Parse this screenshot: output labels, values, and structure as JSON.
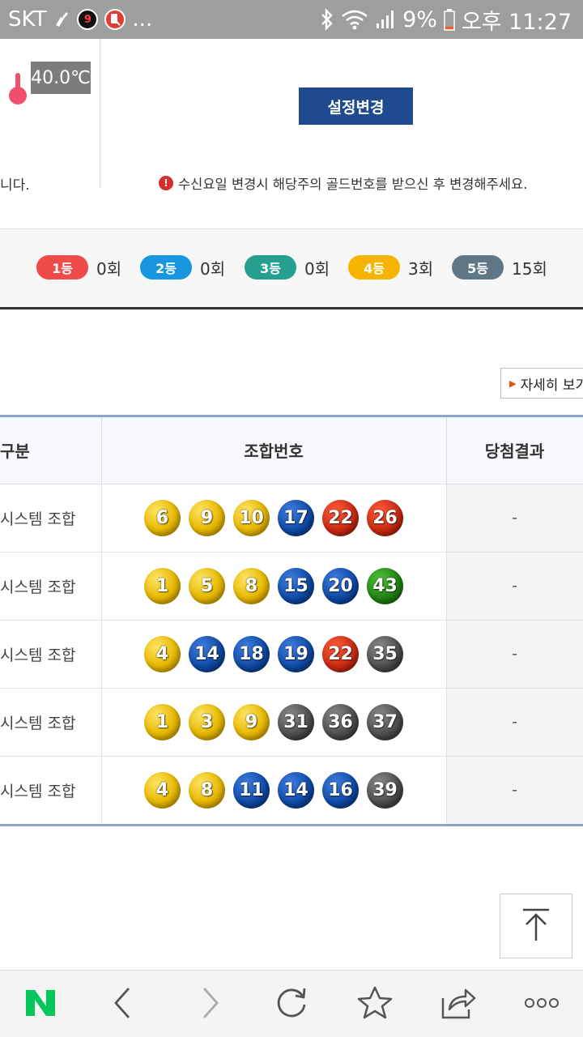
{
  "status_bar": {
    "carrier": "SKT",
    "badge_count": "9",
    "more": "...",
    "battery": "9%",
    "time": "오후 11:27"
  },
  "top": {
    "temperature": "40.0℃",
    "left_note": "니다.",
    "settings_button": "설정변경",
    "notice_text": "수신요일 변경시 해당주의 골드번호를 받으신 후 변경해주세요.",
    "notice_icon": "!"
  },
  "ranks": [
    {
      "label": "1등",
      "count": "0회",
      "color": "#ef4b4b"
    },
    {
      "label": "2등",
      "count": "0회",
      "color": "#1996e0"
    },
    {
      "label": "3등",
      "count": "0회",
      "color": "#25a08f"
    },
    {
      "label": "4등",
      "count": "3회",
      "color": "#f6b400"
    },
    {
      "label": "5등",
      "count": "15회",
      "color": "#5f7784"
    }
  ],
  "detail_button": "자세히 보기",
  "table": {
    "headers": [
      "구분",
      "조합번호",
      "당첨결과"
    ],
    "rows": [
      {
        "type": "시스템 조합",
        "numbers": [
          "6",
          "9",
          "10",
          "17",
          "22",
          "26"
        ],
        "colors": [
          "yellow",
          "yellow",
          "yellow",
          "blue",
          "red",
          "red"
        ],
        "result": "-"
      },
      {
        "type": "시스템 조합",
        "numbers": [
          "1",
          "5",
          "8",
          "15",
          "20",
          "43"
        ],
        "colors": [
          "yellow",
          "yellow",
          "yellow",
          "blue",
          "blue",
          "green"
        ],
        "result": "-"
      },
      {
        "type": "시스템 조합",
        "numbers": [
          "4",
          "14",
          "18",
          "19",
          "22",
          "35"
        ],
        "colors": [
          "yellow",
          "blue",
          "blue",
          "blue",
          "red",
          "gray"
        ],
        "result": "-"
      },
      {
        "type": "시스템 조합",
        "numbers": [
          "1",
          "3",
          "9",
          "31",
          "36",
          "37"
        ],
        "colors": [
          "yellow",
          "yellow",
          "yellow",
          "gray",
          "gray",
          "gray"
        ],
        "result": "-"
      },
      {
        "type": "시스템 조합",
        "numbers": [
          "4",
          "8",
          "11",
          "14",
          "16",
          "39"
        ],
        "colors": [
          "yellow",
          "yellow",
          "blue",
          "blue",
          "blue",
          "gray"
        ],
        "result": "-"
      }
    ]
  },
  "bottom_nav": {
    "logo": "N",
    "logo_color": "#03c75a",
    "items": [
      "naver-home-icon",
      "back-icon",
      "forward-icon",
      "refresh-icon",
      "bookmark-star-icon",
      "share-icon",
      "more-icon"
    ]
  }
}
